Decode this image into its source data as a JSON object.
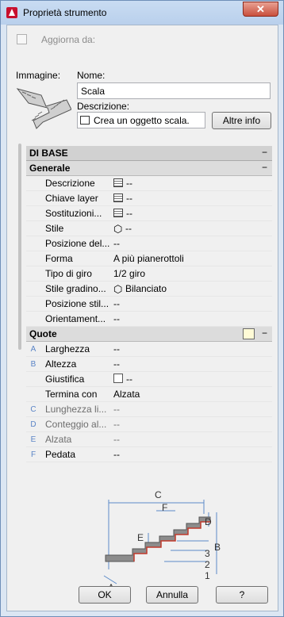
{
  "window": {
    "title": "Proprietà strumento",
    "close_label": "✕"
  },
  "header": {
    "update_label": "Aggiorna da:",
    "image_label": "Immagine:",
    "name_label": "Nome:",
    "name_value": "Scala",
    "description_label": "Descrizione:",
    "description_value": "Crea un oggetto scala.",
    "more_info_label": "Altre info"
  },
  "palette": {
    "section_basic": "DI BASE",
    "group_general": "Generale",
    "general_props": [
      {
        "name": "Descrizione",
        "value": "--",
        "icon": "table-icon"
      },
      {
        "name": "Chiave layer",
        "value": "--",
        "icon": "table-icon"
      },
      {
        "name": "Sostituzioni...",
        "value": "--",
        "icon": "table-icon"
      },
      {
        "name": "Stile",
        "value": "--",
        "icon": "stair-style-icon"
      },
      {
        "name": "Posizione del...",
        "value": "--"
      },
      {
        "name": "Forma",
        "value": "A più pianerottoli"
      },
      {
        "name": "Tipo di giro",
        "value": "1/2 giro"
      },
      {
        "name": "Stile gradino...",
        "value": "Bilanciato",
        "icon": "stair-style-icon"
      },
      {
        "name": "Posizione stil...",
        "value": "--"
      },
      {
        "name": "Orientament...",
        "value": "--"
      }
    ],
    "group_dimensions": "Quote",
    "dimension_props": [
      {
        "key": "A",
        "name": "Larghezza",
        "value": "--"
      },
      {
        "key": "B",
        "name": "Altezza",
        "value": "--"
      },
      {
        "key": "",
        "name": "Giustifica",
        "value": "--",
        "icon": "checkbox-icon"
      },
      {
        "key": "",
        "name": "Termina con",
        "value": "Alzata"
      },
      {
        "key": "C",
        "name": "Lunghezza li...",
        "value": "--",
        "dim": true
      },
      {
        "key": "D",
        "name": "Conteggio al...",
        "value": "--",
        "dim": true
      },
      {
        "key": "E",
        "name": "Alzata",
        "value": "--",
        "dim": true
      },
      {
        "key": "F",
        "name": "Pedata",
        "value": "--"
      }
    ],
    "diagram_labels": [
      "C",
      "F",
      "E",
      "D",
      "B",
      "3",
      "2",
      "1",
      "A"
    ]
  },
  "footer": {
    "ok_label": "OK",
    "cancel_label": "Annulla",
    "help_label": "?"
  }
}
